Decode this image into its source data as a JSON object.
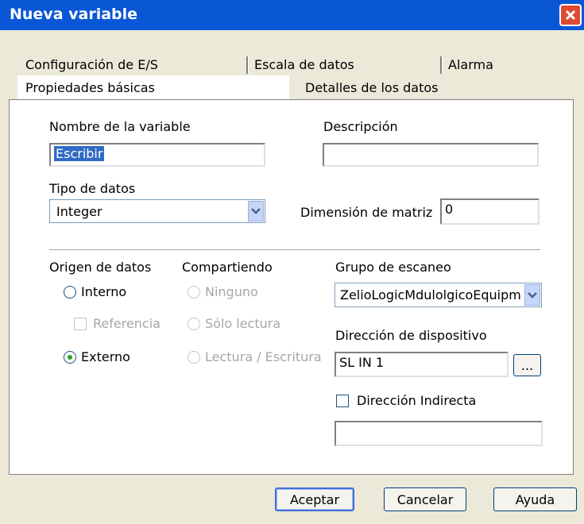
{
  "window": {
    "title": "Nueva variable"
  },
  "tabs": {
    "io_config": "Configuración de E/S",
    "data_scale": "Escala de datos",
    "alarm": "Alarma",
    "basic_props": "Propiedades básicas",
    "data_details": "Detalles de los datos"
  },
  "fields": {
    "var_name_label": "Nombre de la variable",
    "var_name_value": "Escribir",
    "description_label": "Descripción",
    "description_value": "",
    "data_type_label": "Tipo de datos",
    "data_type_value": "Integer",
    "array_dim_label": "Dimensión de matriz",
    "array_dim_value": "0"
  },
  "data_origin": {
    "label": "Origen de datos",
    "internal": "Interno",
    "reference": "Referencia",
    "external": "Externo",
    "selected": "external"
  },
  "sharing": {
    "label": "Compartiendo",
    "none": "Ninguno",
    "read_only": "Sólo lectura",
    "read_write": "Lectura / Escritura"
  },
  "scan": {
    "group_label": "Grupo de escaneo",
    "group_value": "ZelioLogicMdulolgicoEquipm",
    "device_addr_label": "Dirección de dispositivo",
    "device_addr_value": "SL IN 1",
    "browse_label": "...",
    "indirect_label": "Dirección Indirecta",
    "indirect_value": ""
  },
  "buttons": {
    "accept": "Aceptar",
    "cancel": "Cancelar",
    "help": "Ayuda"
  },
  "icons": {
    "close": "close-icon",
    "dropdown": "chevron-down-icon"
  }
}
